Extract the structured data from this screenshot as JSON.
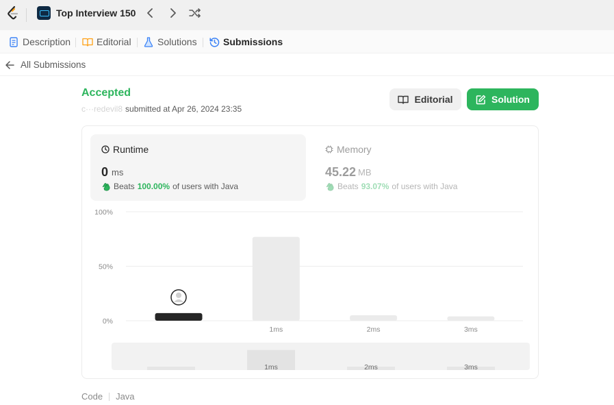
{
  "header": {
    "plan_title": "Top Interview 150"
  },
  "tabs": [
    {
      "label": "Description",
      "icon": "description-icon",
      "active": false
    },
    {
      "label": "Editorial",
      "icon": "editorial-book-icon",
      "active": false
    },
    {
      "label": "Solutions",
      "icon": "flask-icon",
      "active": false
    },
    {
      "label": "Submissions",
      "icon": "history-icon",
      "active": true
    }
  ],
  "back": {
    "label": "All Submissions"
  },
  "submission": {
    "status": "Accepted",
    "user": "c···redevil8",
    "submitted_text": "submitted at Apr 26, 2024 23:35"
  },
  "buttons": {
    "editorial": "Editorial",
    "solution": "Solution"
  },
  "runtime": {
    "label": "Runtime",
    "value": "0",
    "unit": "ms",
    "beats_label": "Beats",
    "beats_pct": "100.00%",
    "beats_suffix": "of users with Java"
  },
  "memory": {
    "label": "Memory",
    "value": "45.22",
    "unit": "MB",
    "beats_label": "Beats",
    "beats_pct": "93.07%",
    "beats_suffix": "of users with Java"
  },
  "code": {
    "label": "Code",
    "language": "Java"
  },
  "colors": {
    "accent_green": "#2db55d",
    "bar_highlight": "#262626",
    "bar_normal": "#ebebeb"
  },
  "chart_data": {
    "type": "bar",
    "title": "",
    "xlabel": "",
    "ylabel": "",
    "ylim": [
      0,
      100
    ],
    "y_ticks": [
      "0%",
      "50%",
      "100%"
    ],
    "categories": [
      "0ms",
      "1ms",
      "2ms",
      "3ms"
    ],
    "x_tick_labels": [
      "",
      "1ms",
      "2ms",
      "3ms"
    ],
    "values": [
      7,
      77,
      5,
      4
    ],
    "highlight_index": 0,
    "overview_labels": [
      "",
      "1ms",
      "2ms",
      "3ms"
    ]
  }
}
